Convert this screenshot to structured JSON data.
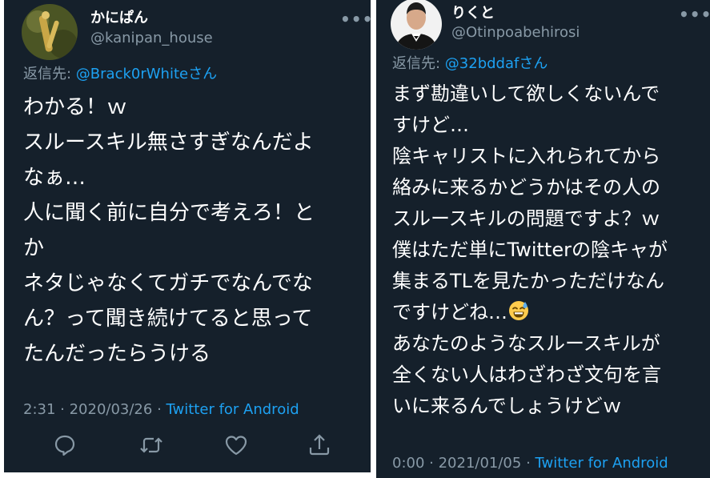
{
  "left_tweet": {
    "display_name": "かにぱん",
    "handle": "@kanipan_house",
    "reply_prefix": "返信先: ",
    "reply_mention": "@Brack0rWhite",
    "reply_suffix": "さん",
    "lines": [
      "わかる！ｗ",
      "スルースキル無さすぎなんだよ",
      "なぁ…",
      "人に聞く前に自分で考えろ！と",
      "か",
      "ネタじゃなくてガチでなんでな",
      "ん？って聞き続けてると思って",
      "たんだったらうける"
    ],
    "time": "2:31",
    "date": "2020/03/26",
    "source": "Twitter for Android",
    "more_label": "•••",
    "actions": [
      "reply-icon",
      "retweet-icon",
      "like-icon",
      "share-icon"
    ]
  },
  "right_tweet": {
    "display_name": "りくと",
    "handle": "@Otinpoabehirosi",
    "reply_prefix": "返信先: ",
    "reply_mention": "@32bddaf",
    "reply_suffix": "さん",
    "lines": [
      "まず勘違いして欲しくないんで",
      "すけど…",
      "陰キャリストに入れられてから",
      "絡みに来るかどうかはその人の",
      "スルースキルの問題ですよ？ｗ",
      "僕はただ単にTwitterの陰キャが",
      "集まるTLを見たかっただけなん",
      "ですけどね…",
      "あなたのようなスルースキルが",
      "全くない人はわざわざ文句を言",
      "いに来るんでしょうけどｗ"
    ],
    "emoji": "sweat-smile-emoji",
    "time": "0:00",
    "date": "2021/01/05",
    "source": "Twitter for Android",
    "more_label": "•••"
  },
  "meta_separator": " · ",
  "colors": {
    "background": "#15202b",
    "text": "#ffffff",
    "secondary": "#8899a6",
    "link": "#1da1f2"
  }
}
